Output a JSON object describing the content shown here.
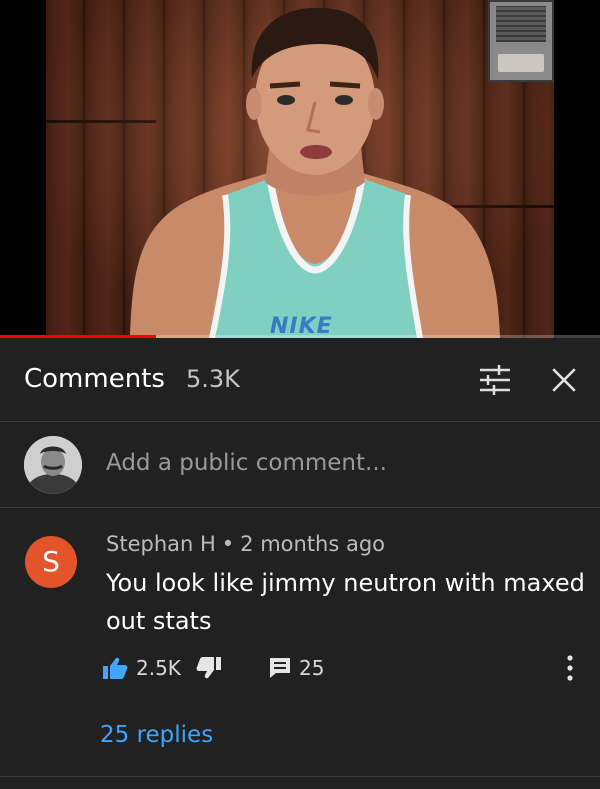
{
  "video": {
    "shirt_logo_text": "NIKE",
    "progress_fraction": 0.26,
    "colors": {
      "progress": "#ff0000",
      "shirt": "#7fd0c0"
    }
  },
  "comments_header": {
    "title": "Comments",
    "count": "5.3K",
    "filter_icon": "sort-filter-icon",
    "close_icon": "close-icon"
  },
  "add_comment": {
    "placeholder": "Add a public comment..."
  },
  "comment": {
    "avatar_letter": "S",
    "author": "Stephan H",
    "separator": "•",
    "time": "2 months ago",
    "text": "You look like jimmy neutron with maxed out stats",
    "likes": "2.5K",
    "reply_count": "25",
    "replies_link": "25 replies",
    "colors": {
      "avatar": "#e4542a",
      "like_icon": "#3ea6ff",
      "link": "#3ea6ff"
    }
  }
}
